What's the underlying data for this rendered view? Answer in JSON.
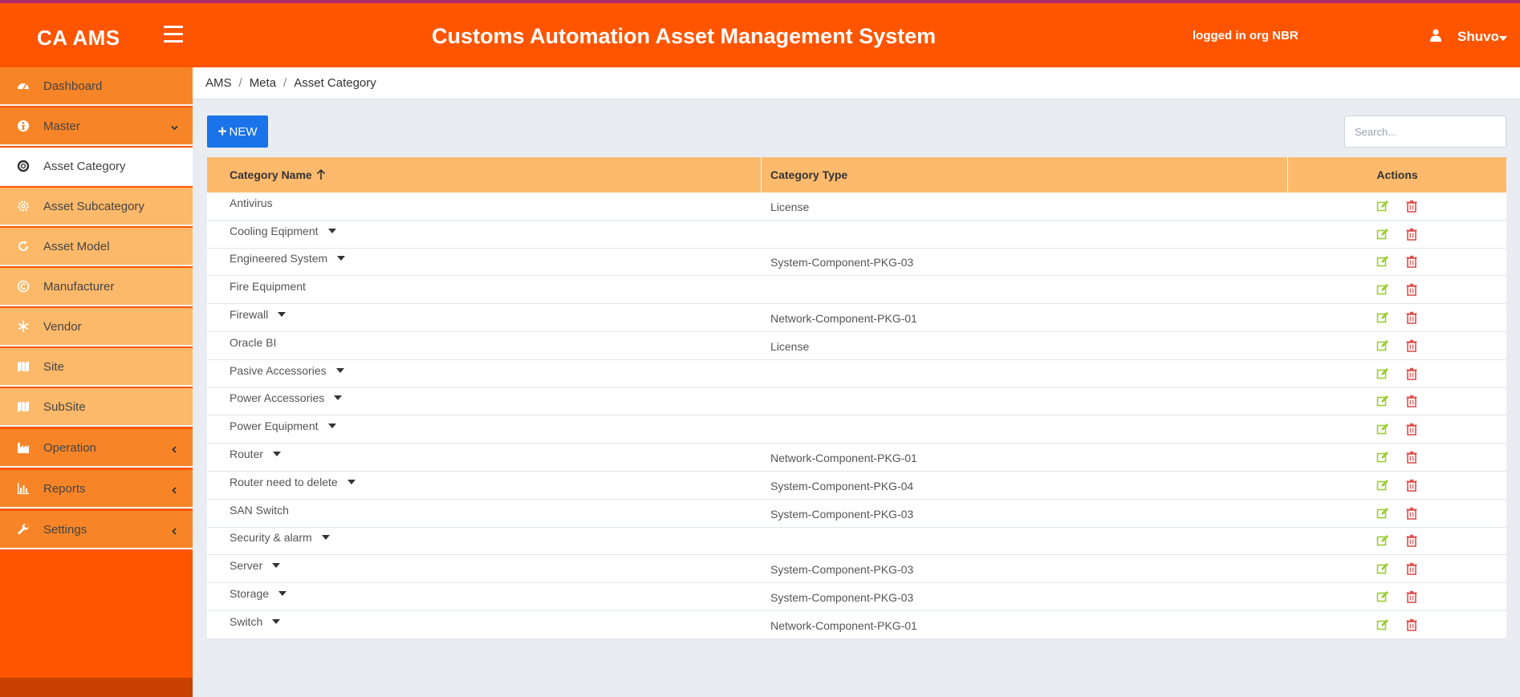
{
  "header": {
    "brand": "CA AMS",
    "title": "Customs Automation Asset Management System",
    "org_label": "logged in org NBR",
    "user": "Shuvo"
  },
  "sidebar": {
    "items": [
      {
        "label": "Dashboard",
        "icon": "dashboard-icon",
        "level": "main"
      },
      {
        "label": "Master",
        "icon": "master-icon",
        "level": "main",
        "chevron": "down"
      },
      {
        "label": "Asset Category",
        "icon": "life-ring-icon",
        "level": "sub",
        "active": true
      },
      {
        "label": "Asset Subcategory",
        "icon": "gear-icon",
        "level": "sub"
      },
      {
        "label": "Asset Model",
        "icon": "refresh-icon",
        "level": "sub"
      },
      {
        "label": "Manufacturer",
        "icon": "copyright-icon",
        "level": "sub"
      },
      {
        "label": "Vendor",
        "icon": "snowflake-icon",
        "level": "sub"
      },
      {
        "label": "Site",
        "icon": "map-icon",
        "level": "sub"
      },
      {
        "label": "SubSite",
        "icon": "map-icon",
        "level": "sub"
      },
      {
        "label": "Operation",
        "icon": "industry-icon",
        "level": "main",
        "chevron": "left"
      },
      {
        "label": "Reports",
        "icon": "bar-chart-icon",
        "level": "main",
        "chevron": "left"
      },
      {
        "label": "Settings",
        "icon": "wrench-icon",
        "level": "main",
        "chevron": "left"
      }
    ]
  },
  "breadcrumb": [
    "AMS",
    "Meta",
    "Asset Category"
  ],
  "toolbar": {
    "new_label": "NEW",
    "search_placeholder": "Search..."
  },
  "table": {
    "columns": [
      "Category Name",
      "Category Type",
      "Actions"
    ],
    "rows": [
      {
        "name": "Antivirus",
        "type": "License",
        "expand": false
      },
      {
        "name": "Cooling Eqipment",
        "type": "",
        "expand": true
      },
      {
        "name": "Engineered System",
        "type": "System-Component-PKG-03",
        "expand": true
      },
      {
        "name": "Fire Equipment",
        "type": "",
        "expand": false
      },
      {
        "name": "Firewall",
        "type": "Network-Component-PKG-01",
        "expand": true
      },
      {
        "name": "Oracle BI",
        "type": "License",
        "expand": false
      },
      {
        "name": "Pasive Accessories",
        "type": "",
        "expand": true
      },
      {
        "name": "Power Accessories",
        "type": "",
        "expand": true
      },
      {
        "name": "Power Equipment",
        "type": "",
        "expand": true
      },
      {
        "name": "Router",
        "type": "Network-Component-PKG-01",
        "expand": true
      },
      {
        "name": "Router need to delete",
        "type": "System-Component-PKG-04",
        "expand": true
      },
      {
        "name": "SAN Switch",
        "type": "System-Component-PKG-03",
        "expand": false
      },
      {
        "name": "Security & alarm",
        "type": "",
        "expand": true
      },
      {
        "name": "Server",
        "type": "System-Component-PKG-03",
        "expand": true
      },
      {
        "name": "Storage",
        "type": "System-Component-PKG-03",
        "expand": true
      },
      {
        "name": "Switch",
        "type": "Network-Component-PKG-01",
        "expand": true
      }
    ]
  },
  "colors": {
    "header": "#ff5500",
    "sidebar_main": "#f78527",
    "sidebar_sub": "#fdb96a",
    "table_head": "#fdba6c",
    "primary_button": "#1a73e8",
    "edit_icon": "#9acd32",
    "delete_icon": "#d9534f"
  }
}
